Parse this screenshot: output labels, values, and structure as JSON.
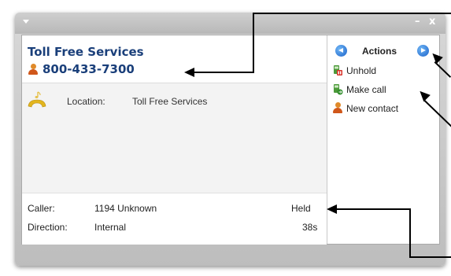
{
  "window": {
    "minimize_glyph": "–",
    "close_glyph": "x"
  },
  "header": {
    "contact_name": "Toll Free Services",
    "phone_number": "800-433-7300"
  },
  "location": {
    "label": "Location:",
    "value": "Toll Free Services"
  },
  "call_info": {
    "caller_label": "Caller:",
    "caller_value": "1194  Unknown",
    "status": "Held",
    "direction_label": "Direction:",
    "direction_value": "Internal",
    "duration": "38s"
  },
  "actions": {
    "title": "Actions",
    "items": [
      {
        "label": "Unhold",
        "icon": "unhold-icon"
      },
      {
        "label": "Make call",
        "icon": "make-call-icon"
      },
      {
        "label": "New contact",
        "icon": "new-contact-icon"
      }
    ]
  },
  "colors": {
    "name_blue": "#1a3f7a",
    "nav_blue": "#1c62c9"
  }
}
